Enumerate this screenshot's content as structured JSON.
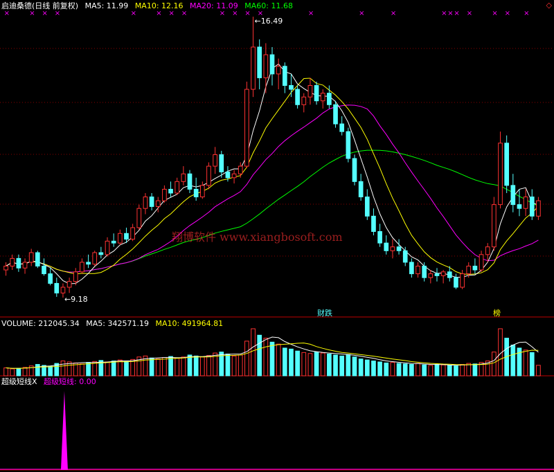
{
  "header": {
    "stock_name": "启迪桑德(日线 前复权)",
    "ma5": "MA5: 11.99",
    "ma10": "MA10: 12.16",
    "ma20": "MA20: 11.09",
    "ma60": "MA60: 11.68"
  },
  "volume_header": {
    "volume": "VOLUME: 212045.34",
    "ma5": "MA5: 342571.19",
    "ma10": "MA10: 491964.81"
  },
  "indicator_header": {
    "name": "超级短线X",
    "line_label": "超级短线: 0.00"
  },
  "annotations": {
    "high": "←16.49",
    "low": "←9.18",
    "watermark": "翔博软件 www.xiangbosoft.com",
    "marker_left": "财跌",
    "marker_right": "榜"
  },
  "colors": {
    "up": "#ff3232",
    "down": "#54ffff",
    "ma5": "#ffffff",
    "ma10": "#ffff00",
    "ma20": "#ff00ff",
    "ma60": "#00ff00",
    "grid": "#8b0000",
    "marker": "#ff00ff"
  },
  "chart_data": [
    {
      "type": "candlestick",
      "title": "启迪桑德(日线 前复权)",
      "ylim": [
        9.0,
        16.6
      ],
      "series": [
        {
          "name": "MA5",
          "values": [
            11.99
          ]
        },
        {
          "name": "MA10",
          "values": [
            12.16
          ]
        },
        {
          "name": "MA20",
          "values": [
            11.09
          ]
        },
        {
          "name": "MA60",
          "values": [
            11.68
          ]
        }
      ],
      "ohlc": [
        [
          9.9,
          10.1,
          9.75,
          10.0
        ],
        [
          10.0,
          10.3,
          9.9,
          10.2
        ],
        [
          10.2,
          10.3,
          9.85,
          9.95
        ],
        [
          9.95,
          10.2,
          9.8,
          10.1
        ],
        [
          10.1,
          10.45,
          10.0,
          10.35
        ],
        [
          10.35,
          10.4,
          9.95,
          10.0
        ],
        [
          10.0,
          10.2,
          9.75,
          9.8
        ],
        [
          9.8,
          9.95,
          9.5,
          9.55
        ],
        [
          9.55,
          9.7,
          9.2,
          9.3
        ],
        [
          9.3,
          9.55,
          9.18,
          9.45
        ],
        [
          9.45,
          9.7,
          9.3,
          9.6
        ],
        [
          9.6,
          9.95,
          9.5,
          9.85
        ],
        [
          9.85,
          10.2,
          9.8,
          10.1
        ],
        [
          10.1,
          10.3,
          9.95,
          10.05
        ],
        [
          10.05,
          10.4,
          10.0,
          10.35
        ],
        [
          10.35,
          10.5,
          10.2,
          10.3
        ],
        [
          10.3,
          10.75,
          10.25,
          10.65
        ],
        [
          10.65,
          10.85,
          10.5,
          10.6
        ],
        [
          10.6,
          10.95,
          10.55,
          10.85
        ],
        [
          10.85,
          11.0,
          10.6,
          10.7
        ],
        [
          10.7,
          11.1,
          10.65,
          11.0
        ],
        [
          11.0,
          11.6,
          10.95,
          11.5
        ],
        [
          11.5,
          11.9,
          11.35,
          11.8
        ],
        [
          11.8,
          11.9,
          11.45,
          11.55
        ],
        [
          11.55,
          11.8,
          11.4,
          11.7
        ],
        [
          11.7,
          12.1,
          11.65,
          12.0
        ],
        [
          12.0,
          12.2,
          11.8,
          11.9
        ],
        [
          11.9,
          12.3,
          11.85,
          12.2
        ],
        [
          12.2,
          12.6,
          12.1,
          12.4
        ],
        [
          12.4,
          12.5,
          11.9,
          12.0
        ],
        [
          12.0,
          12.3,
          11.7,
          11.8
        ],
        [
          11.8,
          12.2,
          11.75,
          12.1
        ],
        [
          12.1,
          12.7,
          12.0,
          12.6
        ],
        [
          12.6,
          13.1,
          12.4,
          12.9
        ],
        [
          12.9,
          13.0,
          12.3,
          12.45
        ],
        [
          12.45,
          12.6,
          12.2,
          12.3
        ],
        [
          12.3,
          12.5,
          12.15,
          12.4
        ],
        [
          12.4,
          12.7,
          12.3,
          12.6
        ],
        [
          12.6,
          14.8,
          12.55,
          14.6
        ],
        [
          14.6,
          16.49,
          14.4,
          15.7
        ],
        [
          15.7,
          15.9,
          14.6,
          14.9
        ],
        [
          14.9,
          15.8,
          14.5,
          15.5
        ],
        [
          15.5,
          15.7,
          14.7,
          15.0
        ],
        [
          15.0,
          15.4,
          14.6,
          15.2
        ],
        [
          15.2,
          15.3,
          14.5,
          14.7
        ],
        [
          14.7,
          15.0,
          14.4,
          14.6
        ],
        [
          14.6,
          14.7,
          14.1,
          14.2
        ],
        [
          14.2,
          14.5,
          14.0,
          14.4
        ],
        [
          14.4,
          14.9,
          14.2,
          14.7
        ],
        [
          14.7,
          14.8,
          14.2,
          14.3
        ],
        [
          14.3,
          14.6,
          14.1,
          14.5
        ],
        [
          14.5,
          14.7,
          14.1,
          14.2
        ],
        [
          14.2,
          14.3,
          13.6,
          13.7
        ],
        [
          13.7,
          13.9,
          13.4,
          13.5
        ],
        [
          13.5,
          13.6,
          12.7,
          12.8
        ],
        [
          12.8,
          12.9,
          12.1,
          12.2
        ],
        [
          12.2,
          12.4,
          11.7,
          11.8
        ],
        [
          11.8,
          12.0,
          11.2,
          11.3
        ],
        [
          11.3,
          11.5,
          10.8,
          10.9
        ],
        [
          10.9,
          11.1,
          10.5,
          10.6
        ],
        [
          10.6,
          10.8,
          10.3,
          10.4
        ],
        [
          10.4,
          10.7,
          10.2,
          10.5
        ],
        [
          10.5,
          10.7,
          10.3,
          10.4
        ],
        [
          10.4,
          10.5,
          10.0,
          10.1
        ],
        [
          10.1,
          10.2,
          9.7,
          9.8
        ],
        [
          9.8,
          10.1,
          9.7,
          10.0
        ],
        [
          10.0,
          10.1,
          9.6,
          9.7
        ],
        [
          9.7,
          9.9,
          9.55,
          9.8
        ],
        [
          9.8,
          9.95,
          9.6,
          9.75
        ],
        [
          9.75,
          9.9,
          9.55,
          9.85
        ],
        [
          9.85,
          10.0,
          9.6,
          9.7
        ],
        [
          9.7,
          9.8,
          9.4,
          9.45
        ],
        [
          9.45,
          9.9,
          9.4,
          9.8
        ],
        [
          9.8,
          10.1,
          9.7,
          10.0
        ],
        [
          10.0,
          10.2,
          9.8,
          9.9
        ],
        [
          9.9,
          10.4,
          9.85,
          10.3
        ],
        [
          10.3,
          10.6,
          10.1,
          10.5
        ],
        [
          10.5,
          11.8,
          10.4,
          11.6
        ],
        [
          11.6,
          13.5,
          11.5,
          13.2
        ],
        [
          13.2,
          13.4,
          11.9,
          12.1
        ],
        [
          12.1,
          12.4,
          11.4,
          11.6
        ],
        [
          11.6,
          12.0,
          11.3,
          11.5
        ],
        [
          11.5,
          12.0,
          11.3,
          11.8
        ],
        [
          11.8,
          12.0,
          11.2,
          11.3
        ],
        [
          11.3,
          11.8,
          11.2,
          11.7
        ]
      ]
    },
    {
      "type": "bar",
      "title": "VOLUME",
      "values": [
        160,
        140,
        150,
        170,
        200,
        230,
        210,
        190,
        250,
        300,
        280,
        260,
        240,
        270,
        290,
        310,
        280,
        300,
        320,
        290,
        330,
        380,
        400,
        360,
        340,
        370,
        390,
        360,
        380,
        420,
        400,
        380,
        410,
        460,
        480,
        440,
        400,
        420,
        700,
        950,
        820,
        760,
        680,
        640,
        560,
        540,
        500,
        470,
        450,
        480,
        460,
        440,
        420,
        400,
        430,
        380,
        340,
        320,
        300,
        280,
        260,
        270,
        250,
        240,
        230,
        250,
        220,
        210,
        230,
        220,
        210,
        200,
        230,
        250,
        240,
        270,
        300,
        480,
        950,
        760,
        620,
        560,
        520,
        470,
        212
      ],
      "series": [
        {
          "name": "MA5",
          "values": [
            342571.19
          ]
        },
        {
          "name": "MA10",
          "values": [
            491964.81
          ]
        }
      ]
    },
    {
      "type": "bar",
      "title": "超级短线X",
      "series": [
        {
          "name": "超级短线",
          "values": [
            0.0
          ]
        }
      ],
      "values": [
        0,
        0,
        0,
        0,
        0,
        0,
        0,
        0,
        0,
        1,
        0,
        0,
        0,
        0,
        0,
        0,
        0,
        0,
        0,
        0,
        0,
        0,
        0,
        0,
        0,
        0,
        0,
        0,
        0,
        0,
        0,
        0,
        0,
        0,
        0,
        0,
        0,
        0,
        0,
        0,
        0,
        0,
        0,
        0,
        0,
        0,
        0,
        0,
        0,
        0,
        0,
        0,
        0,
        0,
        0,
        0,
        0,
        0,
        0,
        0,
        0,
        0,
        0,
        0,
        0,
        0,
        0,
        0,
        0,
        0,
        0,
        0,
        0,
        0,
        0,
        0,
        0,
        0,
        0,
        0,
        0,
        0,
        0,
        0,
        0
      ]
    }
  ]
}
